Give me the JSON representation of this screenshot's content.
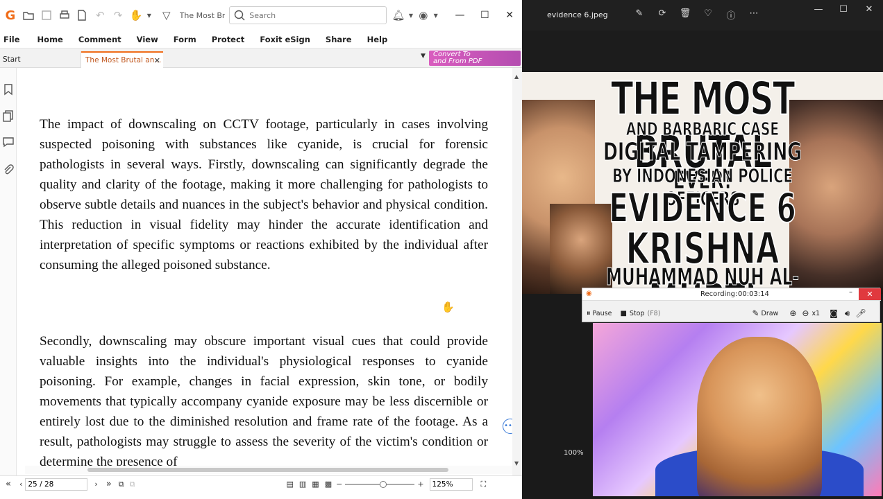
{
  "foxit": {
    "doc_title": "The Most Br...",
    "search_placeholder": "Search",
    "menu": [
      "File",
      "Home",
      "Comment",
      "View",
      "Form",
      "Protect",
      "Foxit eSign",
      "Share",
      "Help"
    ],
    "tabs": {
      "start": "Start",
      "doc": "The Most Brutal an..."
    },
    "convert": {
      "line1": "Convert To",
      "line2": "and From PDF"
    },
    "paragraphs": [
      "The impact of downscaling on CCTV footage, particularly in cases involving suspected poisoning with substances like cyanide, is crucial for forensic pathologists in several ways. Firstly, downscaling can significantly degrade the quality and clarity of the footage, making it more challenging for pathologists to observe subtle details and nuances in the subject's behavior and physical condition. This reduction in visual fidelity may hinder the accurate identification and interpretation of specific symptoms or reactions exhibited by the individual after consuming the alleged poisoned substance.",
      "Secondly, downscaling may obscure important visual cues that could provide valuable insights into the individual's physiological responses to cyanide poisoning. For example, changes in facial expression, skin tone, or bodily movements that typically accompany cyanide exposure may be less discernible or entirely lost due to the diminished resolution and frame rate of the footage. As a result, pathologists may struggle to assess the severity of the victim's condition or determine the presence of"
    ],
    "status": {
      "page": "25 / 28",
      "zoom": "125%"
    }
  },
  "viewer": {
    "file_name": "evidence 6.jpeg",
    "thumbnail_lines": [
      "THE MOST BRUTAL",
      "AND BARBARIC CASE",
      "DIGITAL TAMPERING EVER!",
      "BY INDONESIAN POLICE OFFICERS",
      "EVIDENCE 6",
      "KRISHNA MURTI",
      "MUHAMMAD NUH AL-AZHAR"
    ],
    "zoom": "100%"
  },
  "recorder": {
    "status_label": "Recording:",
    "time": "00:03:14",
    "pause": "Pause",
    "stop": "Stop",
    "stop_key": "(F8)",
    "draw": "Draw",
    "zoom_factor": "x1"
  }
}
